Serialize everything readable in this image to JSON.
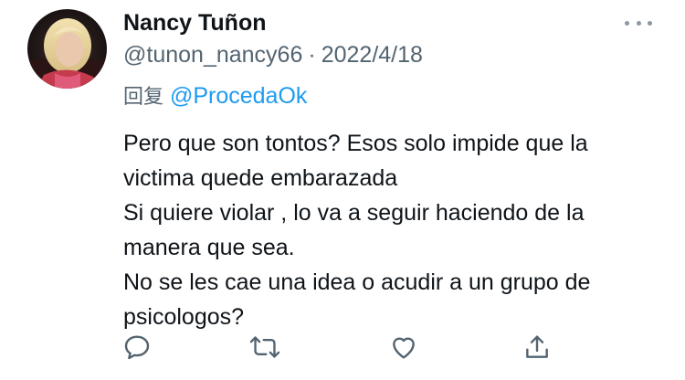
{
  "tweet": {
    "author": {
      "name": "Nancy Tuñon",
      "handle": "@tunon_nancy66",
      "avatar": "profile-photo"
    },
    "date": "2022/4/18",
    "separator": "·",
    "reply": {
      "prefix": "回复",
      "to": "@ProcedaOk"
    },
    "body_lines": [
      "Pero que son tontos? Esos solo impide que la",
      "victima quede embarazada",
      "Si quiere violar , lo va a seguir haciendo de la",
      "manera que sea.",
      "No se les cae una idea o acudir a un grupo de",
      "psicologos?"
    ],
    "actions": [
      {
        "icon": "reply-icon"
      },
      {
        "icon": "retweet-icon"
      },
      {
        "icon": "like-icon"
      },
      {
        "icon": "share-icon"
      }
    ],
    "more_icon": "more-options-icon"
  },
  "colors": {
    "text": "#0f1419",
    "secondary": "#536471",
    "link": "#1d9bf0",
    "icon": "#536471"
  }
}
